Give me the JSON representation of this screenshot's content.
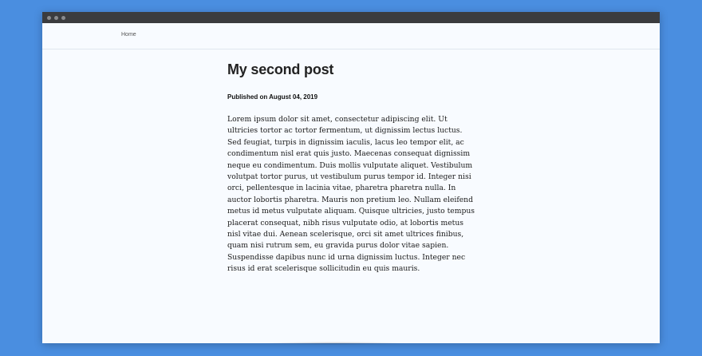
{
  "nav": {
    "home_label": "Home"
  },
  "post": {
    "title": "My second post",
    "meta": "Published on August 04, 2019",
    "body": "Lorem ipsum dolor sit amet, consectetur adipiscing elit. Ut ultricies tortor ac tortor fermentum, ut dignissim lectus luctus. Sed feugiat, turpis in dignissim iaculis, lacus leo tempor elit, ac condimentum nisl erat quis justo. Maecenas consequat dignissim neque eu condimentum. Duis mollis vulputate aliquet. Vestibulum volutpat tortor purus, ut vestibulum purus tempor id. Integer nisi orci, pellentesque in lacinia vitae, pharetra pharetra nulla. In auctor lobortis pharetra. Mauris non pretium leo. Nullam eleifend metus id metus vulputate aliquam. Quisque ultricies, justo tempus placerat consequat, nibh risus vulputate odio, at lobortis metus nisl vitae dui. Aenean scelerisque, orci sit amet ultrices finibus, quam nisi rutrum sem, eu gravida purus dolor vitae sapien. Suspendisse dapibus nunc id urna dignissim luctus. Integer nec risus id erat scelerisque sollicitudin eu quis mauris."
  },
  "colors": {
    "background": "#4a8ee0",
    "titlebar": "#3b3c3e",
    "page": "#f8fbff"
  }
}
